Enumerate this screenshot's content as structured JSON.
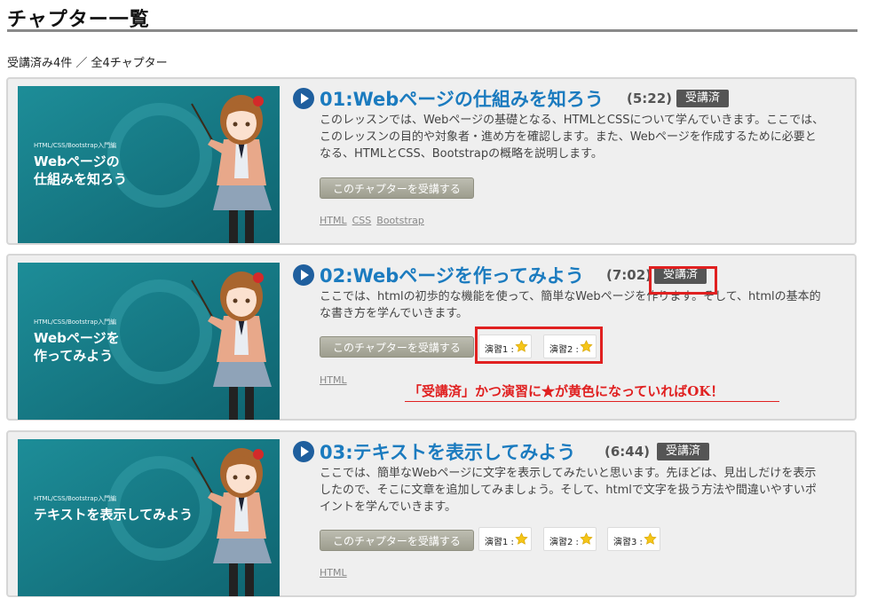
{
  "page": {
    "title": "チャプター一覧",
    "summary": "受講済み4件 ／ 全4チャプター"
  },
  "colors": {
    "accent": "#1b7bbf",
    "badge": "#555555",
    "highlight": "#e02020",
    "thumbnail_bg": "#177a87",
    "star": "#f5c518"
  },
  "chapters": [
    {
      "title": "01:Webページの仕組みを知ろう",
      "duration": "(5:22)",
      "status": "受講済",
      "description": "このレッスンでは、Webページの基礎となる、HTMLとCSSについて学んでいきます。ここでは、このレッスンの目的や対象者・進め方を確認します。また、Webページを作成するために必要となる、HTMLとCSS、Bootstrapの概略を説明します。",
      "button": "このチャプターを受講する",
      "thumb_sub": "HTML/CSS/Bootstrap入門編",
      "thumb_title": "Webページの\n仕組みを知ろう",
      "tags": [
        "HTML",
        "CSS",
        "Bootstrap"
      ],
      "exercises": []
    },
    {
      "title": "02:Webページを作ってみよう",
      "duration": "(7:02)",
      "status": "受講済",
      "description": "ここでは、htmlの初歩的な機能を使って、簡単なWebページを作ります。そして、htmlの基本的な書き方を学んでいきます。",
      "button": "このチャプターを受講する",
      "thumb_sub": "HTML/CSS/Bootstrap入門編",
      "thumb_title": "Webページを\n作ってみよう",
      "tags": [
        "HTML"
      ],
      "exercises": [
        {
          "label": "演習1 :",
          "icon": "star-icon"
        },
        {
          "label": "演習2 :",
          "icon": "star-icon"
        }
      ]
    },
    {
      "title": "03:テキストを表示してみよう",
      "duration": "(6:44)",
      "status": "受講済",
      "description": "ここでは、簡単なWebページに文字を表示してみたいと思います。先ほどは、見出しだけを表示したので、そこに文章を追加してみましょう。そして、htmlで文字を扱う方法や間違いやすいポイントを学んでいきます。",
      "button": "このチャプターを受講する",
      "thumb_sub": "HTML/CSS/Bootstrap入門編",
      "thumb_title": "テキストを表示してみよう",
      "tags": [
        "HTML"
      ],
      "exercises": [
        {
          "label": "演習1 :",
          "icon": "star-icon"
        },
        {
          "label": "演習2 :",
          "icon": "star-icon"
        },
        {
          "label": "演習3 :",
          "icon": "star-icon"
        }
      ]
    }
  ],
  "annotation": "「受講済」かつ演習に★が黄色になっていればOK！"
}
